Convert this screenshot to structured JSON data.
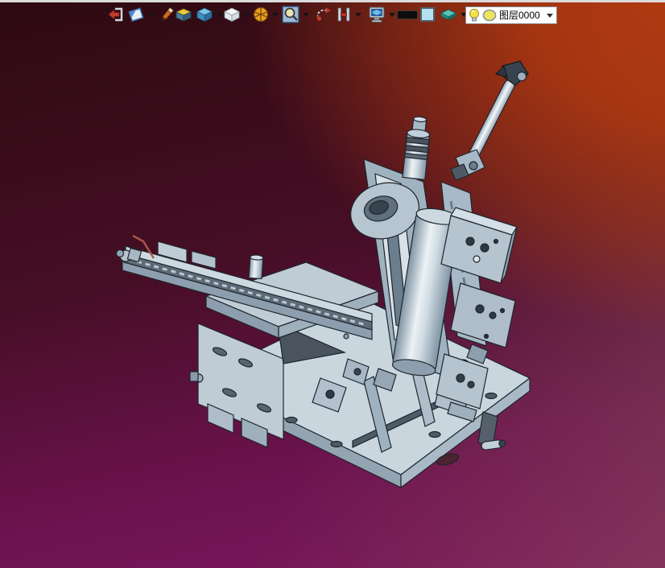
{
  "toolbar": {
    "items": [
      {
        "id": "exit",
        "icon": "exit-door-arrow-icon",
        "dropdown": false
      },
      {
        "id": "view-orientation",
        "icon": "view-plane-icon",
        "dropdown": true
      },
      {
        "id": "sketch",
        "icon": "pencil-icon",
        "dropdown": false
      },
      {
        "id": "solid-box",
        "icon": "box-yellow-top-icon",
        "dropdown": false
      },
      {
        "id": "shaded-display",
        "icon": "shaded-cube-icon",
        "dropdown": true
      },
      {
        "id": "wireframe-display",
        "icon": "wireframe-cube-icon",
        "dropdown": true
      },
      {
        "id": "segment-sphere",
        "icon": "orange-segmented-sphere-icon",
        "dropdown": true
      },
      {
        "id": "zoom-window",
        "icon": "magnifier-square-icon",
        "dropdown": true
      },
      {
        "id": "orbit",
        "icon": "orbit-rotate-icon",
        "dropdown": false
      },
      {
        "id": "dimension",
        "icon": "h-beam-icon",
        "dropdown": true
      },
      {
        "id": "render",
        "icon": "monitor-render-icon",
        "dropdown": true
      },
      {
        "id": "line-width",
        "icon": "line-width-swatch-icon",
        "dropdown": false
      },
      {
        "id": "color",
        "icon": "color-swatch-icon",
        "dropdown": false
      },
      {
        "id": "layers",
        "icon": "layer-slab-icon",
        "dropdown": true
      }
    ],
    "layer_selector": {
      "value": "图层0000",
      "state_icons": [
        "lightbulb-on-icon",
        "layer-color-swatch-icon"
      ]
    },
    "line_width_swatch_color": "#0d0d0d",
    "color_swatch_color": "#b5e0ef"
  },
  "viewport": {
    "model": "3d-machine-fixture-assembly",
    "model_color": "#c0cfd9",
    "background_gradient": {
      "top_left": "#2e0a11",
      "top_right": "#ab3412",
      "bottom_left": "#7b1560",
      "bottom_center": "#772b55",
      "bottom_right": "#7a4452"
    }
  }
}
